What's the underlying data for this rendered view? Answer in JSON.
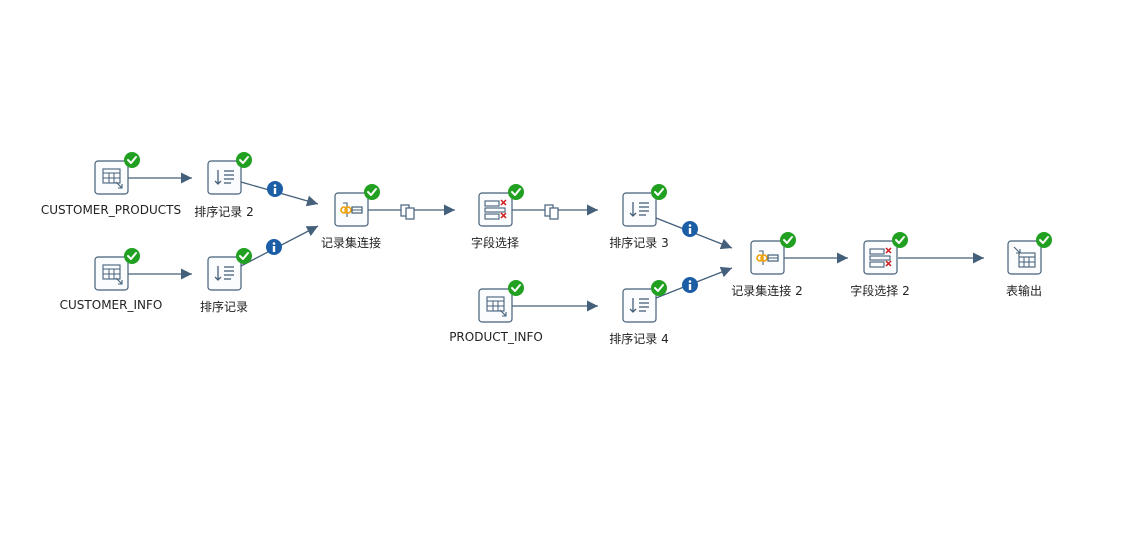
{
  "colors": {
    "hop": "#44607a",
    "node_border": "#44607a",
    "node_fill": "#fbfcfd",
    "check": "#21a021",
    "info": "#1b5ea6",
    "copy_icon": "#44607a",
    "red_x": "#d11a1a",
    "orange": "#f0a000"
  },
  "steps": {
    "customer_products": {
      "label": "CUSTOMER_PRODUCTS",
      "icon": "table-input-icon"
    },
    "customer_info": {
      "label": "CUSTOMER_INFO",
      "icon": "table-input-icon"
    },
    "product_info": {
      "label": "PRODUCT_INFO",
      "icon": "table-input-icon"
    },
    "sort2": {
      "label": "排序记录 2",
      "icon": "sort-icon"
    },
    "sort1": {
      "label": "排序记录",
      "icon": "sort-icon"
    },
    "sort3": {
      "label": "排序记录 3",
      "icon": "sort-icon"
    },
    "sort4": {
      "label": "排序记录 4",
      "icon": "sort-icon"
    },
    "join1": {
      "label": "记录集连接",
      "icon": "merge-join-icon"
    },
    "join2": {
      "label": "记录集连接 2",
      "icon": "merge-join-icon"
    },
    "select1": {
      "label": "字段选择",
      "icon": "select-values-icon"
    },
    "select2": {
      "label": "字段选择 2",
      "icon": "select-values-icon"
    },
    "output": {
      "label": "表输出",
      "icon": "table-output-icon"
    }
  }
}
